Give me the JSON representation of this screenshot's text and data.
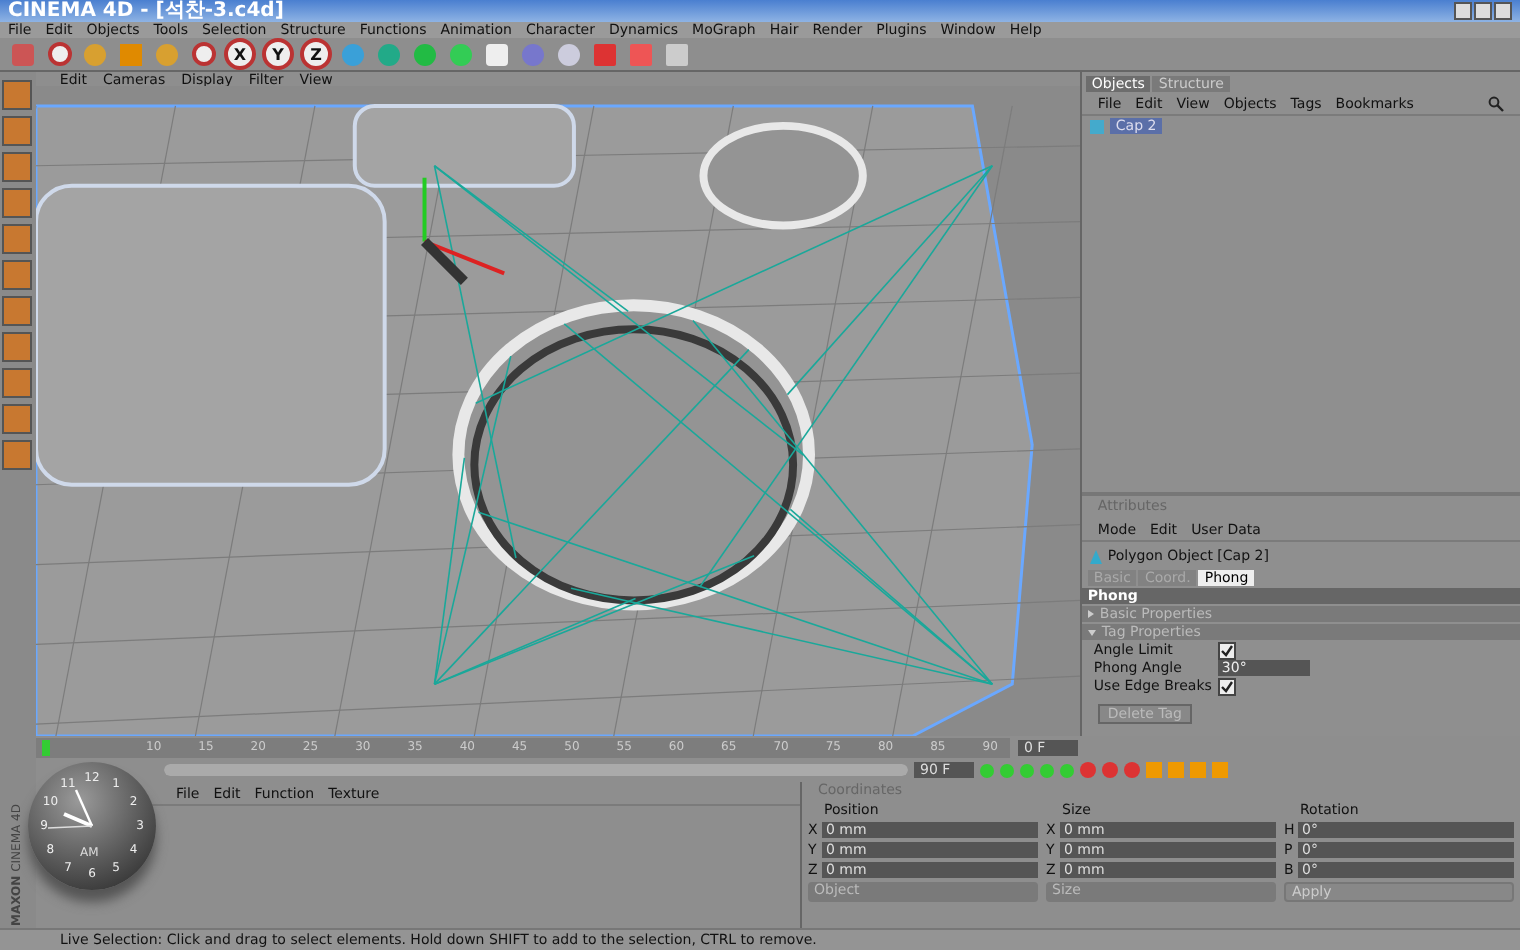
{
  "window": {
    "title": "CINEMA 4D - [석찬-3.c4d]"
  },
  "menu": [
    "File",
    "Edit",
    "Objects",
    "Tools",
    "Selection",
    "Structure",
    "Functions",
    "Animation",
    "Character",
    "Dynamics",
    "MoGraph",
    "Hair",
    "Render",
    "Plugins",
    "Window",
    "Help"
  ],
  "axis_buttons": [
    "X",
    "Y",
    "Z"
  ],
  "viewport": {
    "menu": [
      "Edit",
      "Cameras",
      "Display",
      "Filter",
      "View"
    ]
  },
  "objects_panel": {
    "tabs": [
      {
        "label": "Objects",
        "selected": true
      },
      {
        "label": "Structure",
        "selected": false
      }
    ],
    "menu": [
      "File",
      "Edit",
      "View",
      "Objects",
      "Tags",
      "Bookmarks"
    ],
    "rows": [
      {
        "name": "Cap 2",
        "selected": true
      }
    ]
  },
  "attributes": {
    "title": "Attributes",
    "menu": [
      "Mode",
      "Edit",
      "User Data"
    ],
    "object": "Polygon Object [Cap 2]",
    "tabs": [
      {
        "label": "Basic",
        "selected": false
      },
      {
        "label": "Coord.",
        "selected": false
      },
      {
        "label": "Phong",
        "selected": true
      }
    ],
    "section": "Phong",
    "groups": [
      {
        "label": "Basic Properties",
        "expanded": false
      },
      {
        "label": "Tag Properties",
        "expanded": true
      }
    ],
    "fields": [
      {
        "kind": "checkbox",
        "label": "Angle Limit",
        "checked": true
      },
      {
        "kind": "number",
        "label": "Phong Angle",
        "value": "30°"
      },
      {
        "kind": "checkbox",
        "label": "Use Edge Breaks",
        "checked": true
      }
    ],
    "button": "Delete Tag"
  },
  "timeline": {
    "range": {
      "level": 1
    },
    "ticks": [
      "10",
      "15",
      "20",
      "25",
      "30",
      "35",
      "40",
      "45",
      "50",
      "55",
      "60",
      "65",
      "70",
      "75",
      "80",
      "85",
      "90"
    ],
    "current_frame": "0 F",
    "end_frame": "90 F"
  },
  "clock": {
    "numbers": [
      "12",
      "1",
      "2",
      "3",
      "4",
      "5",
      "6",
      "7",
      "8",
      "9",
      "10",
      "11"
    ],
    "period": "AM"
  },
  "materials": {
    "menu": [
      "File",
      "Edit",
      "Function",
      "Texture"
    ]
  },
  "coordinates": {
    "title": "Coordinates",
    "headers": [
      "Position",
      "Size",
      "Rotation"
    ],
    "rows": [
      {
        "axis": "X",
        "position": "0 mm",
        "size_axis": "X",
        "size": "0 mm",
        "rot_axis": "H",
        "rotation": "0°"
      },
      {
        "axis": "Y",
        "position": "0 mm",
        "size_axis": "Y",
        "size": "0 mm",
        "rot_axis": "P",
        "rotation": "0°"
      },
      {
        "axis": "Z",
        "position": "0 mm",
        "size_axis": "Z",
        "size": "0 mm",
        "rot_axis": "B",
        "rotation": "0°"
      }
    ],
    "mode": "Object",
    "size_mode": "Size",
    "apply": "Apply"
  },
  "logo": {
    "brand": "MAXON",
    "product": "CINEMA 4D"
  },
  "status_bar": "Live Selection: Click and drag to select elements. Hold down SHIFT to add to the selection, CTRL to remove."
}
